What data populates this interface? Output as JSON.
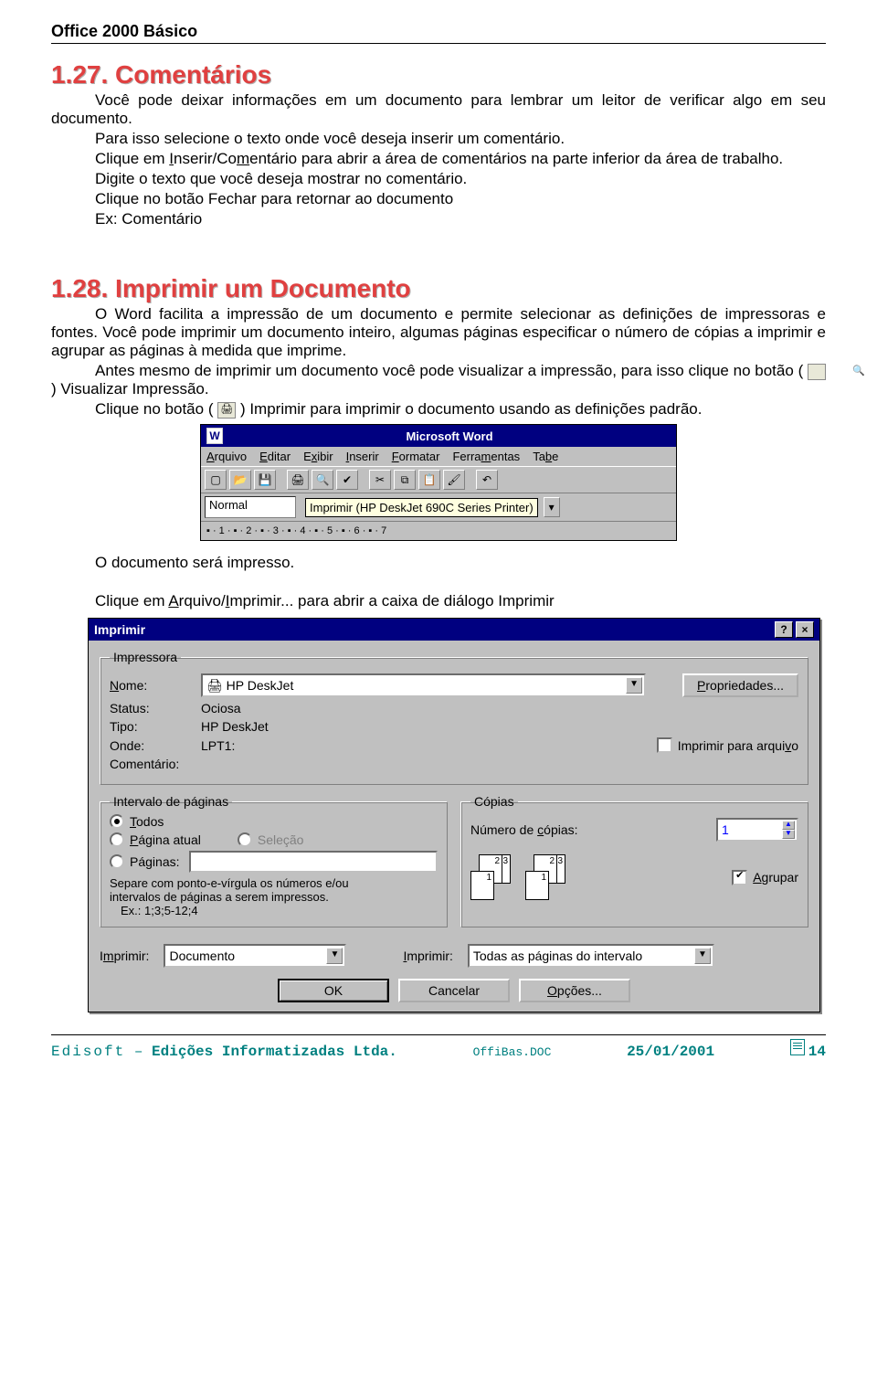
{
  "header": {
    "title": "Office 2000 Básico"
  },
  "section127": {
    "heading": "1.27. Comentários",
    "p1": "Você pode deixar informações em um documento para lembrar um leitor de verificar algo em seu documento.",
    "p2": "Para isso selecione o texto onde você deseja inserir um comentário.",
    "p3a": "Clique em ",
    "p3_link1": "I",
    "p3b": "nserir/Co",
    "p3_link2": "m",
    "p3c": "entário para abrir a área de comentários na parte inferior da área de trabalho.",
    "p4": "Digite o texto que você deseja mostrar no comentário.",
    "p5": "Clique no botão Fechar para retornar ao documento",
    "p6": "Ex: Comentário"
  },
  "section128": {
    "heading": "1.28. Imprimir um Documento",
    "p1": "O Word facilita a impressão de um documento e permite selecionar as definições de impressoras e fontes.  Você pode imprimir um documento inteiro, algumas páginas especificar o número de cópias a imprimir e agrupar as páginas à medida que imprime.",
    "p2a": "Antes mesmo de imprimir um documento você pode visualizar a impressão, para isso clique no botão (",
    "p2b": ") Visualizar Impressão.",
    "p3a": "Clique no botão (",
    "p3b": ") Imprimir  para imprimir o documento usando as definições padrão.",
    "p4": "O documento será impresso.",
    "p5a": "Clique em ",
    "p5_u1": "A",
    "p5b": "rquivo/",
    "p5_u2": "I",
    "p5c": "mprimir... para abrir a caixa de diálogo Imprimir"
  },
  "word_ss": {
    "title": "Microsoft Word",
    "menu": [
      "Arquivo",
      "Editar",
      "Exibir",
      "Inserir",
      "Formatar",
      "Ferramentas",
      "Tabe"
    ],
    "menu_u": [
      "A",
      "E",
      "E",
      "I",
      "F",
      "m",
      "b"
    ],
    "style": "Normal",
    "tooltip": "Imprimir (HP DeskJet 690C Series Printer)",
    "ruler": "▪ · 1 · ▪ · 2 · ▪ · 3 · ▪ · 4 · ▪ · 5 · ▪ · 6 · ▪ · 7"
  },
  "dlg": {
    "title": "Imprimir",
    "grp_printer": "Impressora",
    "name_lbl": "Nome:",
    "name_val": "HP DeskJet",
    "props_btn": "Propriedades...",
    "status_lbl": "Status:",
    "status_val": "Ociosa",
    "type_lbl": "Tipo:",
    "type_val": "HP DeskJet",
    "where_lbl": "Onde:",
    "where_val": "LPT1:",
    "comment_lbl": "Comentário:",
    "print_to_file": "Imprimir para arquivo",
    "grp_range": "Intervalo de páginas",
    "r_all": "Todos",
    "r_current": "Página atual",
    "r_selection": "Seleção",
    "r_pages": "Páginas:",
    "range_help1": "Separe com ponto-e-vírgula os números e/ou",
    "range_help2": "intervalos de páginas a serem impressos.",
    "range_help3": "Ex.: 1;3;5-12;4",
    "grp_copies": "Cópias",
    "copies_lbl": "Número de cópias:",
    "copies_val": "1",
    "collate": "Agrupar",
    "print_what_lbl": "Imprimir:",
    "print_what_val": "Documento",
    "print_range_lbl": "Imprimir:",
    "print_range_val": "Todas as páginas do intervalo",
    "ok": "OK",
    "cancel": "Cancelar",
    "options": "Opções...",
    "p1": "1",
    "p2": "2",
    "p3": "3"
  },
  "footer": {
    "brand": "Edisoft",
    "dash": " – ",
    "company": "Edições Informatizadas Ltda.",
    "file": "OffiBas.DOC",
    "date": "25/01/2001",
    "page": "14"
  }
}
